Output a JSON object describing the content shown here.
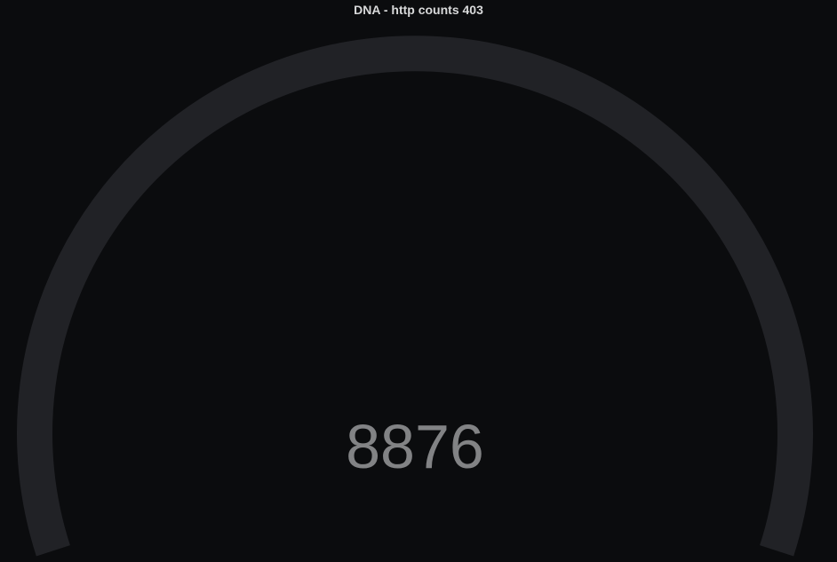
{
  "panel": {
    "title": "DNA - http counts 403"
  },
  "gauge": {
    "value": "8876",
    "track_color": "#212226",
    "value_color": "#828385",
    "background_color": "#0b0c0e"
  }
}
